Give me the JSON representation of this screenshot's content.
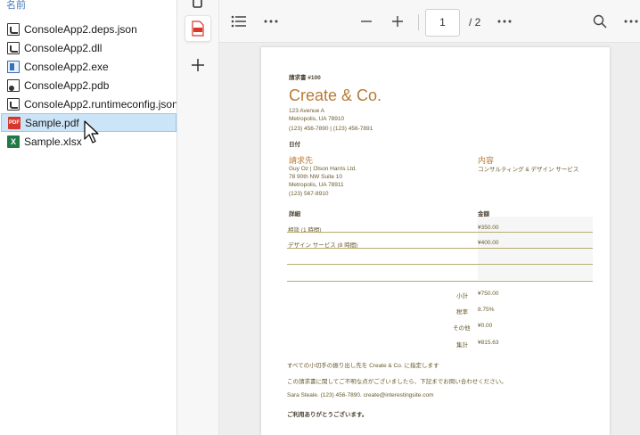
{
  "explorer": {
    "column_header": "名前",
    "files": [
      {
        "name": "ConsoleApp2.deps.json",
        "icon": "generic-file-icon"
      },
      {
        "name": "ConsoleApp2.dll",
        "icon": "generic-file-icon"
      },
      {
        "name": "ConsoleApp2.exe",
        "icon": "exe-file-icon"
      },
      {
        "name": "ConsoleApp2.pdb",
        "icon": "pdb-file-icon"
      },
      {
        "name": "ConsoleApp2.runtimeconfig.json",
        "icon": "generic-file-icon"
      },
      {
        "name": "Sample.pdf",
        "icon": "pdf-file-icon",
        "selected": true
      },
      {
        "name": "Sample.xlsx",
        "icon": "excel-file-icon"
      }
    ],
    "pdf_icon_text": "PDF",
    "xlsx_icon_text": "X"
  },
  "viewer": {
    "current_page": "1",
    "total_pages": "/ 2",
    "strip_icons": [
      "copy-icon",
      "pdf-document-icon",
      "plus-icon"
    ],
    "toolbar_icons": [
      "contents-list-icon",
      "more-icon",
      "zoom-out-icon",
      "zoom-in-icon",
      "more-icon",
      "search-icon",
      "more-icon"
    ]
  },
  "document": {
    "invoice_number": "請求書 #100",
    "company_name": "Create & Co.",
    "company_address_1": "123 Avenue A",
    "company_address_2": "Metropolis, UA 78910",
    "company_phones": "(123) 456-7890 | (123) 456-7891",
    "date_label": "日付",
    "bill_to_label": "請求先",
    "bill_to_name": "Guy Oz | Olson Harris Ltd.",
    "bill_to_address_1": "78 90th NW Suite 10",
    "bill_to_address_2": "Metropolis, UA 78911",
    "bill_to_phone": "(123) 567-8910",
    "content_label": "内容",
    "content_value": "コンサルティング & デザイン サービス",
    "details_header": "詳細",
    "amount_header": "金額",
    "items": [
      {
        "description": "相談 (1 時間)",
        "amount": "¥350.00"
      },
      {
        "description": "デザイン サービス (8 時間)",
        "amount": "¥400.00"
      }
    ],
    "subtotal_label": "小計",
    "subtotal_value": "¥750.00",
    "tax_label": "税率",
    "tax_value": "8.75%",
    "other_label": "その他",
    "other_value": "¥0.00",
    "total_label": "集計",
    "total_value": "¥815.63",
    "note_1": "すべての小切手の振り出し先を Create & Co. に指定します",
    "note_2": "この請求書に関してご不明な点がございましたら、下記までお問い合わせください。",
    "contact": "Sara Steale. (123) 456-7890. create@interestingsite.com",
    "thanks": "ご利用ありがとうございます。"
  },
  "colors": {
    "brand": "#b87a36",
    "text": "#6a5a2c",
    "rule": "#b8ad6e",
    "selection": "#cce4f7",
    "pdf_red": "#d9352b",
    "excel_green": "#1f7a45"
  }
}
